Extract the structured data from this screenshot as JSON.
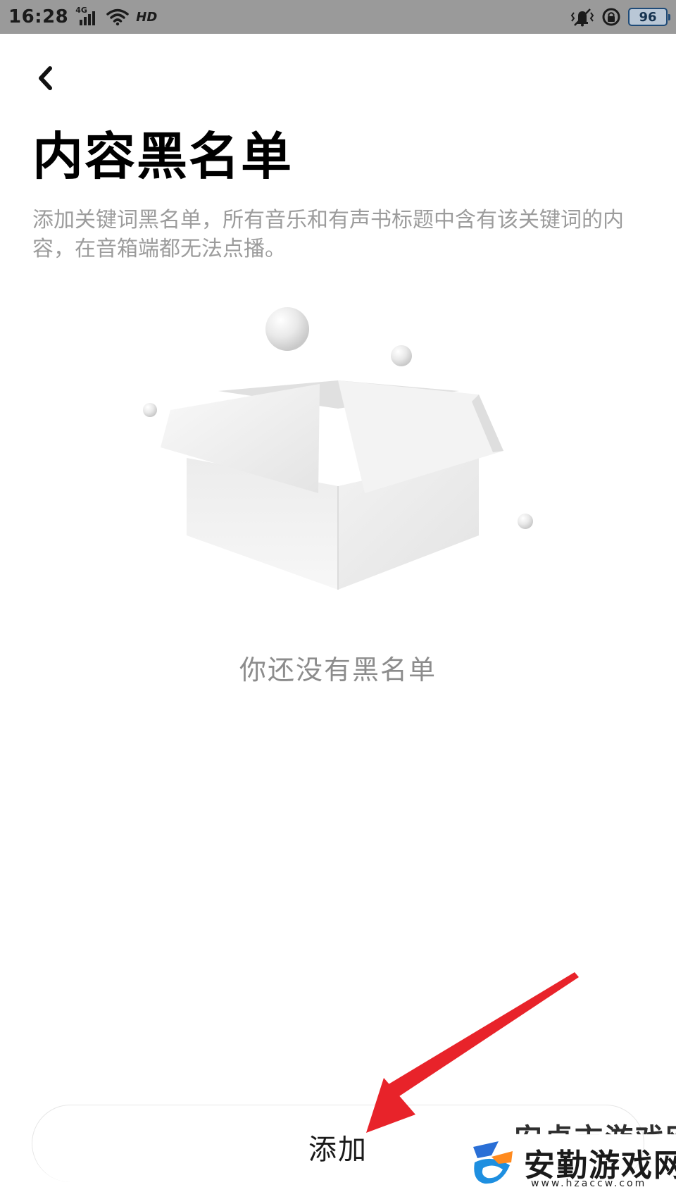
{
  "status_bar": {
    "time": "16:28",
    "network": "4G",
    "hd": "HD",
    "battery": "96",
    "icons": [
      "signal-icon",
      "wifi-icon",
      "hd-icon",
      "vibrate-icon",
      "rotation-lock-icon",
      "battery-icon"
    ]
  },
  "header": {
    "back_icon": "chevron-left-icon",
    "title": "内容黑名单",
    "description": "添加关键词黑名单，所有音乐和有声书标题中含有该关键词的内容，在音箱端都无法点播。"
  },
  "empty_state": {
    "illustration": "empty-box",
    "text": "你还没有黑名单"
  },
  "bottom": {
    "add_label": "添加"
  },
  "annotation": {
    "arrow_color": "#e8232a"
  },
  "watermark": {
    "partial_text": "安卓市游戏网",
    "name": "安勤游戏网",
    "url": "www.hzaccw.com"
  }
}
